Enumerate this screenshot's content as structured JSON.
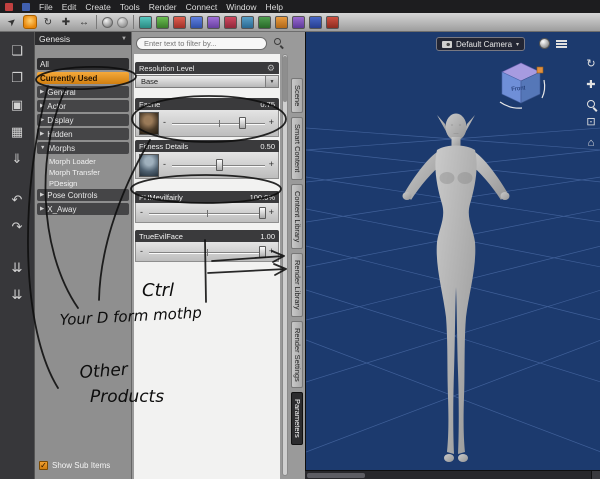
{
  "menubar": {
    "items": [
      "File",
      "Edit",
      "Create",
      "Tools",
      "Render",
      "Connect",
      "Window",
      "Help"
    ]
  },
  "left_toolbar": {
    "icons": [
      {
        "name": "new-file-icon",
        "glyph": "❏"
      },
      {
        "name": "open-file-icon",
        "glyph": "❐"
      },
      {
        "name": "save-file-icon",
        "glyph": "▣"
      },
      {
        "name": "save-as-icon",
        "glyph": "▦"
      },
      {
        "name": "import-icon",
        "glyph": "⇓"
      },
      {
        "name": "undo-icon",
        "glyph": "↶"
      },
      {
        "name": "redo-icon",
        "glyph": "↷"
      },
      {
        "name": "collapse-all-icon",
        "glyph": "⇊"
      },
      {
        "name": "expand-all-icon",
        "glyph": "⇊"
      }
    ]
  },
  "figure_panel": {
    "title": "Genesis",
    "dropdown_glyph": "▼",
    "arrow_collapsed": "▶",
    "arrow_expanded": "▼",
    "items": [
      {
        "label": "All"
      },
      {
        "label": "Currently Used"
      },
      {
        "label": "General"
      },
      {
        "label": "Actor"
      },
      {
        "label": "Display"
      },
      {
        "label": "Hidden"
      },
      {
        "label": "Morphs"
      },
      {
        "label": "Morph Loader"
      },
      {
        "label": "Morph Transfer"
      },
      {
        "label": "PDesign"
      },
      {
        "label": "Pose Controls"
      },
      {
        "label": "X_Away"
      }
    ],
    "checkbox_glyph": "✓",
    "show_sub_items": "Show Sub Items"
  },
  "parameters_panel": {
    "filter_placeholder": "Enter text to filter by...",
    "resolution_header": "Resolution Level",
    "resolution_value": "Base",
    "gear_glyph": "⚙",
    "dropdown_glyph": "▼",
    "minus": "-",
    "plus": "+",
    "sliders": [
      {
        "name": "Faerie",
        "value": "0.75"
      },
      {
        "name": "Fitness Details",
        "value": "0.50"
      },
      {
        "name": "PHMevilfairly",
        "value": "100.0%"
      },
      {
        "name": "TrueEvilFace",
        "value": "1.00"
      }
    ]
  },
  "side_tabs": {
    "labels": [
      "Scene",
      "Smart Content",
      "Content Library",
      "Render Library",
      "Render Settings",
      "Parameters"
    ],
    "active": "Parameters"
  },
  "viewport": {
    "camera_label": "Default Camera",
    "camera_dropdown_glyph": "▾",
    "cube_front_label": "Front",
    "controls": [
      {
        "name": "orbit-icon",
        "glyph": "↻"
      },
      {
        "name": "pan-icon",
        "glyph": "✚"
      },
      {
        "name": "frame-icon",
        "glyph": "⊡"
      },
      {
        "name": "home-icon",
        "glyph": "⌂"
      }
    ]
  },
  "annotations": {
    "ctrl": "Ctrl",
    "morph_note": "Your D form mothp",
    "products_line1": "Other",
    "products_line2": "Products"
  },
  "colors": {
    "accent_orange": "#e8920a",
    "viewport_bg": "#1c3a6e",
    "grid_line": "#4c6da8",
    "panel_dark": "#3a3a3c"
  }
}
